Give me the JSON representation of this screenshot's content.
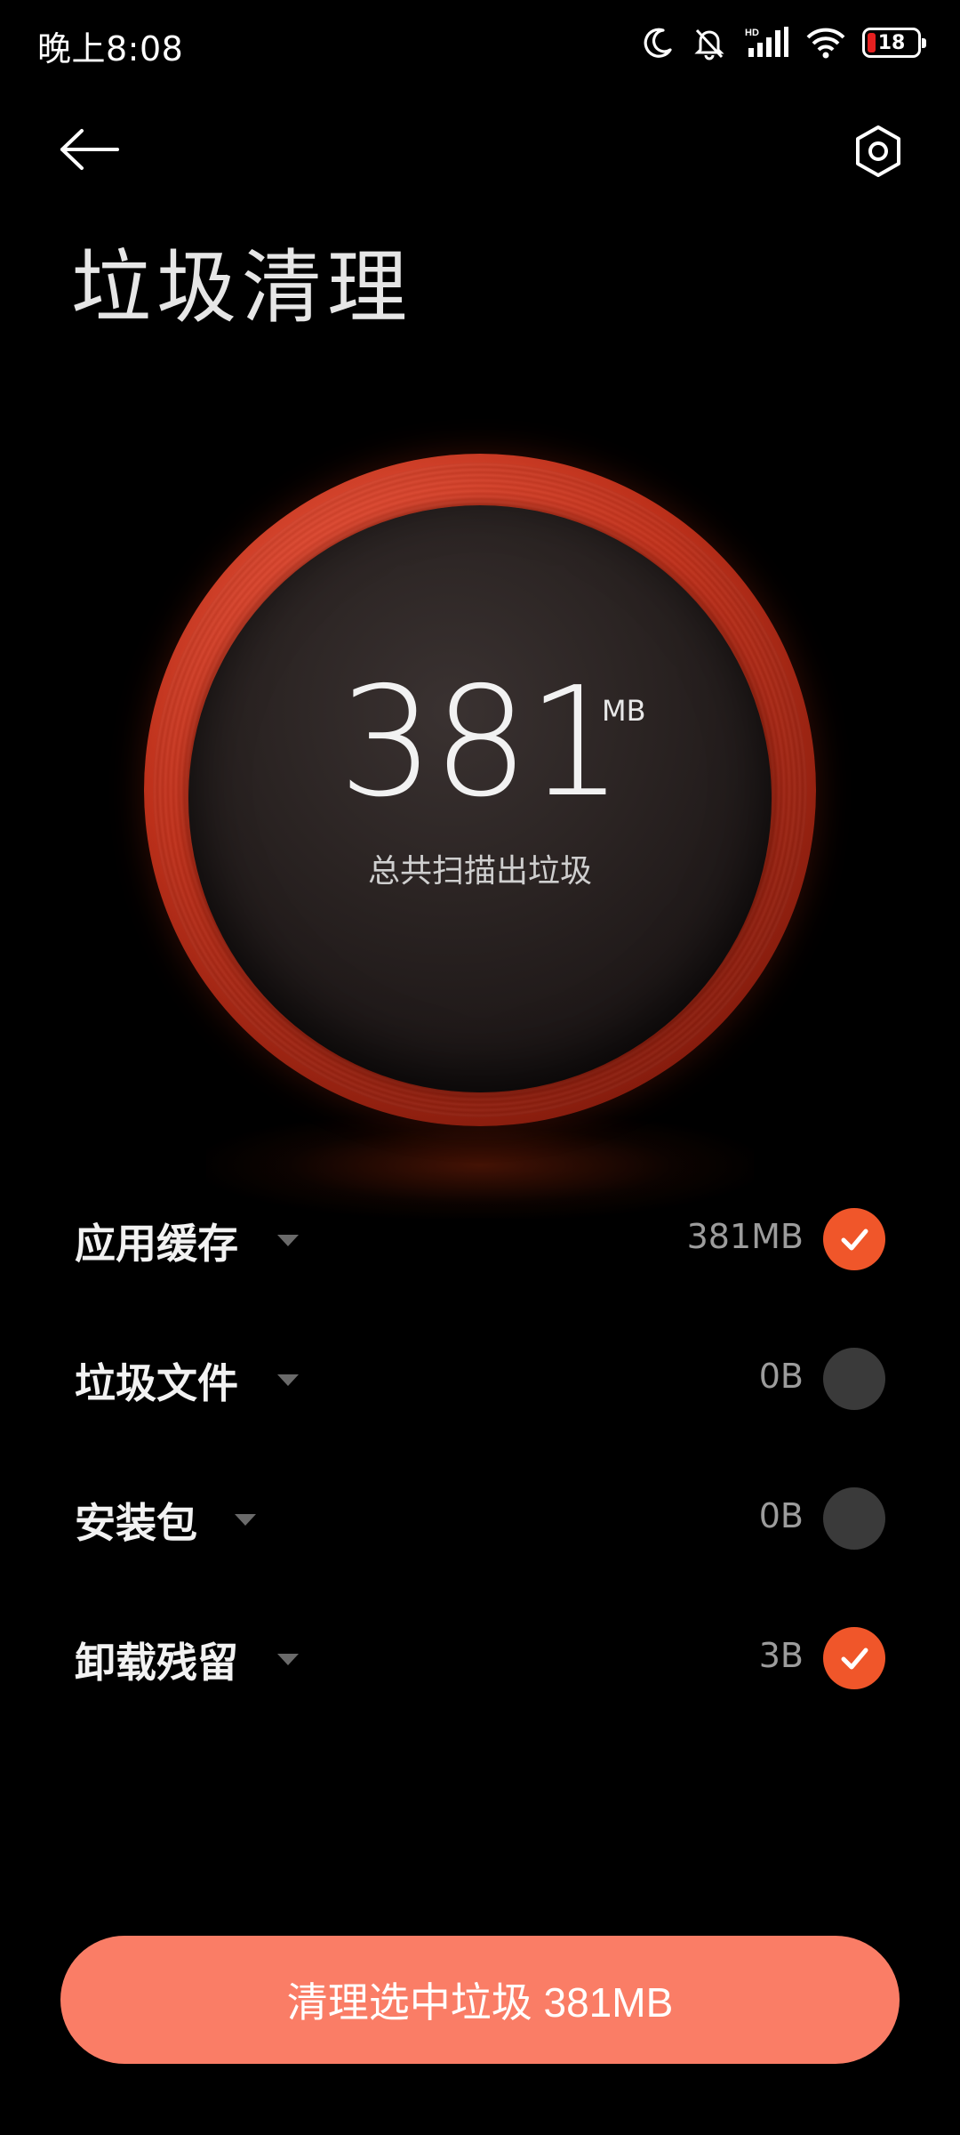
{
  "status_bar": {
    "time": "晚上8:08",
    "battery_level": "18",
    "icons": [
      "moon-icon",
      "bell-off-icon",
      "signal-hd-icon",
      "wifi-icon",
      "battery-icon"
    ]
  },
  "header": {
    "title": "垃圾清理",
    "back_icon": "arrow-left-icon",
    "settings_icon": "settings-hex-icon"
  },
  "summary": {
    "total_value": "381",
    "total_unit": "MB",
    "caption": "总共扫描出垃圾"
  },
  "items": [
    {
      "label": "应用缓存",
      "size": "381MB",
      "checked": true
    },
    {
      "label": "垃圾文件",
      "size": "0B",
      "checked": false
    },
    {
      "label": "安装包",
      "size": "0B",
      "checked": false
    },
    {
      "label": "卸载残留",
      "size": "3B",
      "checked": true
    }
  ],
  "action": {
    "clean_button_label": "清理选中垃圾 381MB"
  },
  "colors": {
    "accent": "#f0562a",
    "button": "#fa7d66",
    "background": "#000000"
  }
}
